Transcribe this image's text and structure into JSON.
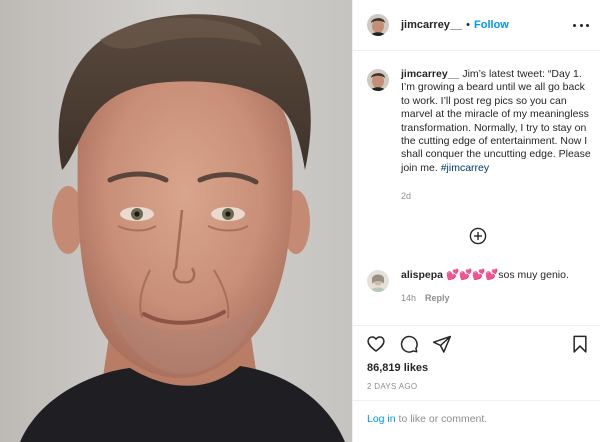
{
  "header": {
    "username": "jimcarrey__",
    "separator": "•",
    "follow_label": "Follow",
    "more_icon": "more-options-icon"
  },
  "caption": {
    "username": "jimcarrey__",
    "text": "Jim’s latest tweet: “Day 1. I’m growing a beard until we all go back to work. I’ll post reg pics so you can marvel at the miracle of my meaningless transformation. Normally, I try to stay on the cutting edge of entertainment. Now I shall conquer the uncutting edge. Please join me. ",
    "hashtag": "#jimcarrey",
    "age": "2d"
  },
  "load_more_icon": "plus-circle-icon",
  "comment": {
    "username": "alispepa",
    "emoji": "💕💕💕💕",
    "text": "sos muy genio.",
    "age": "14h",
    "reply_label": "Reply"
  },
  "actions": {
    "like_icon": "heart-icon",
    "comment_icon": "comment-icon",
    "share_icon": "share-icon",
    "save_icon": "bookmark-icon"
  },
  "likes": "86,819 likes",
  "posted_time": "2 DAYS AGO",
  "login": {
    "link_label": "Log in",
    "rest": " to like or comment."
  },
  "colors": {
    "accent": "#0095f6",
    "text": "#262626",
    "muted": "#8e8e8e",
    "hashtag": "#00376b",
    "border": "#efefef"
  }
}
